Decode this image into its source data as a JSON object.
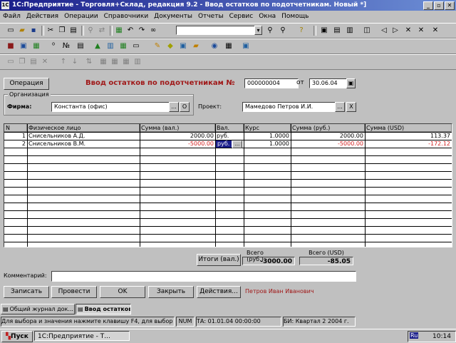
{
  "window": {
    "title": "1С:Предприятие - Торговля+Склад, редакция 9.2 - Ввод остатков по подотчетникам. Новый *]",
    "app_icon": "1C",
    "buttons": [
      "_",
      "▫",
      "✕"
    ]
  },
  "menu": [
    "Файл",
    "Действия",
    "Операции",
    "Справочники",
    "Документы",
    "Отчеты",
    "Сервис",
    "Окна",
    "Помощь"
  ],
  "toolbar": {
    "search_value": ""
  },
  "form": {
    "operation_button": "Операция",
    "title": "Ввод остатков по подотчетникам №",
    "doc_number": "000000004",
    "date_label": "от",
    "date_value": "30.06.04",
    "org_group_label": "Организация",
    "firm_label": "Фирма:",
    "firm_value": "Константа (офис)",
    "project_label": "Проект:",
    "project_value": "Мамедово Петров И.И.",
    "ellipsis": "...",
    "clear_x": "X",
    "calendar_icon": "calendar-icon",
    "open_icon": "O"
  },
  "table": {
    "columns": [
      "N",
      "Физическое лицо",
      "Сумма (вал.)",
      "Вал.",
      "Курс",
      "Сумма (руб.)",
      "Сумма (USD)"
    ],
    "rows": [
      {
        "n": "1",
        "person": "Снисельников А.Д.",
        "sum_val": "2000.00",
        "cur": "руб.",
        "rate": "1.0000",
        "sum_rub": "2000.00",
        "sum_usd": "113.37",
        "negative": false
      },
      {
        "n": "2",
        "person": "Снисельников В.М.",
        "sum_val": "-5000.00",
        "cur": "руб.",
        "rate": "1.0000",
        "sum_rub": "-5000.00",
        "sum_usd": "-172.12",
        "negative": true
      }
    ]
  },
  "totals": {
    "button": "Итоги (вал.)",
    "rub_label": "Всего (руб.)",
    "rub_value": "-3000.00",
    "usd_label": "Всего (USD)",
    "usd_value": "-85.05"
  },
  "comment": {
    "label": "Комментарий:",
    "value": ""
  },
  "actions": {
    "write": "Записать",
    "post": "Провести",
    "ok": "OK",
    "close": "Закрыть",
    "more": "Действия...",
    "author": "Петров Иван Иванович"
  },
  "doc_tabs": [
    "Общий журнал док...",
    "Ввод остатков ..."
  ],
  "status": {
    "hint": "Для выбора и значения нажмите клавишу F4, для выбор",
    "num": "NUM",
    "ta": "ТА: 01.01.04 00:00:00",
    "bi": "БИ: Квартал 2 2004 г."
  },
  "taskbar": {
    "start": "Пуск",
    "app": "1С:Предприятие - Т...",
    "lang": "Ru",
    "time": "10:14"
  }
}
